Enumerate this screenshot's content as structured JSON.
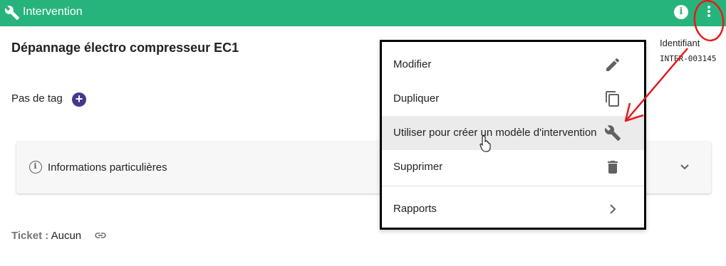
{
  "header": {
    "title": "Intervention",
    "icon": "wrench-icon",
    "bg_color": "#27b47c",
    "info_icon": "info-icon",
    "more_icon": "more-vert-icon"
  },
  "main": {
    "title": "Dépannage électro compresseur EC1",
    "identifier_label": "Identifiant",
    "identifier_value": "INTER-003145",
    "tags_label": "Pas de tag",
    "add_tag_icon": "add-circle-icon",
    "panel": {
      "label": "Informations particulières",
      "icon": "info-outline-icon",
      "expand_icon": "chevron-down-icon"
    },
    "ticket": {
      "label": "Ticket :",
      "value": "Aucun",
      "icon": "link-icon"
    }
  },
  "menu": {
    "items": [
      {
        "label": "Modifier",
        "icon": "pencil-icon"
      },
      {
        "label": "Dupliquer",
        "icon": "copy-icon"
      },
      {
        "label": "Utiliser pour créer un modèle d'intervention",
        "icon": "wrench-icon"
      },
      {
        "label": "Supprimer",
        "icon": "trash-icon"
      },
      {
        "label": "Rapports",
        "icon": "chevron-right-icon"
      }
    ],
    "hovered_item": "Utiliser pour créer un modèle d'intervention"
  },
  "annotations": {
    "color": "#e31b1b",
    "circle_target": "more-vert-icon",
    "arrow_target": "Utiliser pour créer un modèle d'intervention"
  },
  "cursor": "hand-pointer-icon"
}
